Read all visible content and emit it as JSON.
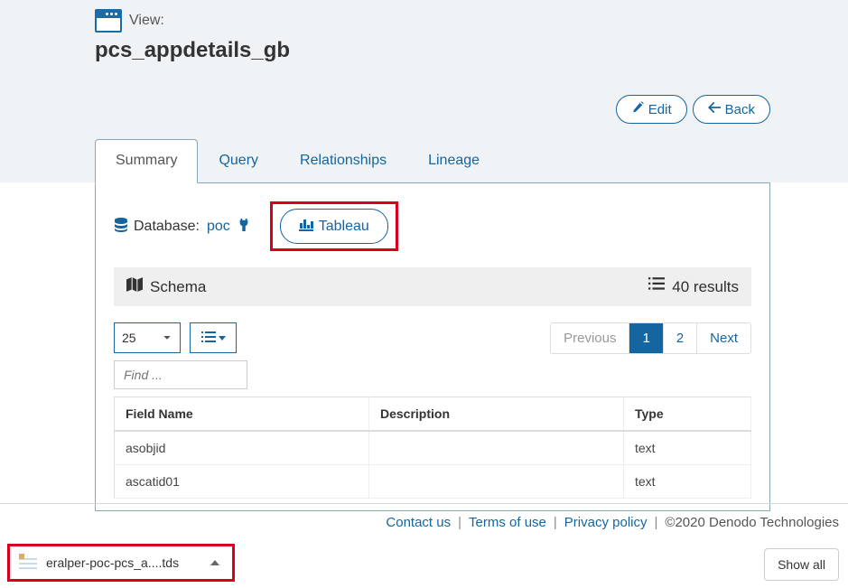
{
  "header": {
    "view_label": "View:",
    "title": "pcs_appdetails_gb"
  },
  "actions": {
    "edit_label": "Edit",
    "back_label": "Back"
  },
  "tabs": [
    {
      "label": "Summary",
      "active": true
    },
    {
      "label": "Query",
      "active": false
    },
    {
      "label": "Relationships",
      "active": false
    },
    {
      "label": "Lineage",
      "active": false
    }
  ],
  "database": {
    "label": "Database:",
    "name": "poc",
    "tableau_label": "Tableau"
  },
  "schema": {
    "title": "Schema",
    "results_text": "40 results"
  },
  "controls": {
    "page_size_value": "25",
    "find_placeholder": "Find ..."
  },
  "pagination": {
    "previous": "Previous",
    "pages": [
      "1",
      "2"
    ],
    "next": "Next",
    "active_index": 0
  },
  "table": {
    "columns": [
      "Field Name",
      "Description",
      "Type"
    ],
    "rows": [
      {
        "field": "asobjid",
        "desc": "",
        "type": "text"
      },
      {
        "field": "ascatid01",
        "desc": "",
        "type": "text"
      }
    ]
  },
  "footer": {
    "contact": "Contact us",
    "terms": "Terms of use",
    "privacy": "Privacy policy",
    "copyright": "©2020 Denodo Technologies"
  },
  "download": {
    "filename": "eralper-poc-pcs_a....tds"
  },
  "showall": "Show all"
}
